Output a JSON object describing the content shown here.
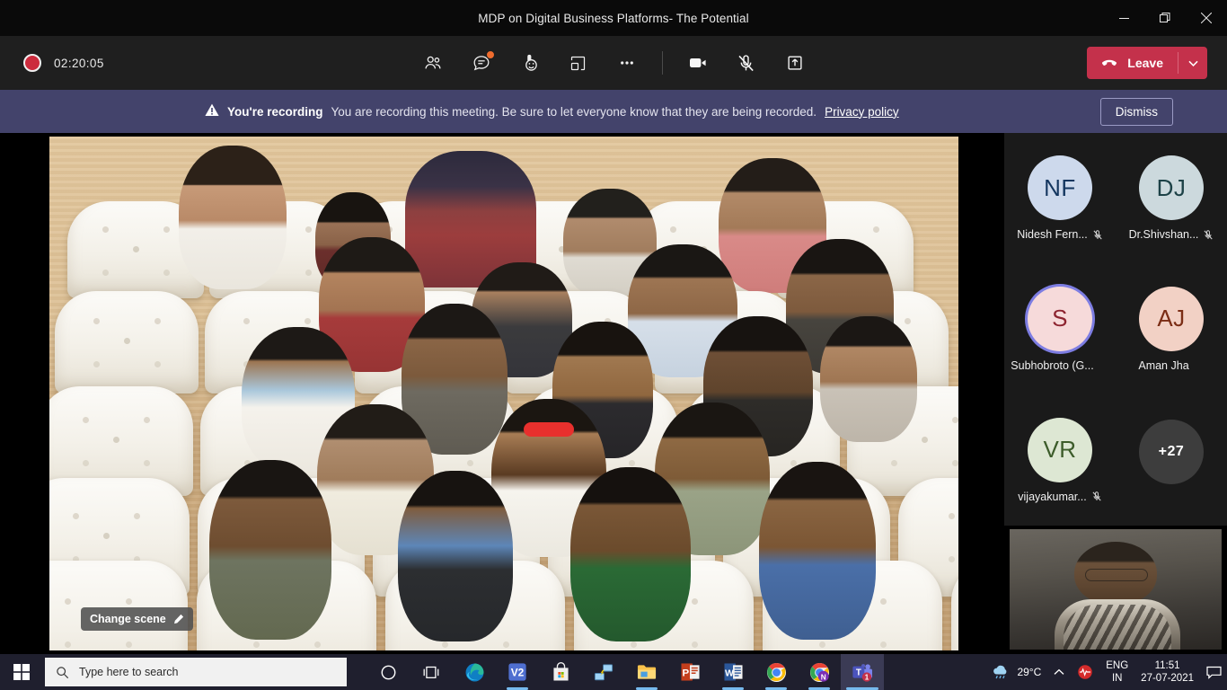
{
  "window": {
    "title": "MDP on Digital Business Platforms- The Potential",
    "controls": {
      "minimize": "minimize-button",
      "restore": "restore-button",
      "close": "close-button"
    }
  },
  "toolbar": {
    "recording_time": "02:20:05",
    "buttons": [
      {
        "name": "show-participants",
        "icon": "people-icon",
        "label": "People"
      },
      {
        "name": "show-conversation",
        "icon": "chat-icon",
        "label": "Chat",
        "badge": true
      },
      {
        "name": "show-reactions",
        "icon": "reactions-icon",
        "label": "React"
      },
      {
        "name": "breakout-rooms",
        "icon": "breakout-rooms-icon",
        "label": "Rooms"
      },
      {
        "name": "more-actions",
        "icon": "ellipsis-icon",
        "label": "More"
      }
    ],
    "camera": {
      "name": "camera-toggle",
      "icon": "camera-icon",
      "state": "on"
    },
    "mic": {
      "name": "mic-toggle",
      "icon": "mic-muted-icon",
      "state": "muted"
    },
    "share": {
      "name": "share-content",
      "icon": "share-screen-icon"
    },
    "leave_label": "Leave",
    "leave_caret": "chevron-down-icon"
  },
  "banner": {
    "warning_icon": "warning-triangle-icon",
    "strong": "You're recording",
    "text": "You are recording this meeting. Be sure to let everyone know that they are being recorded.",
    "link": "Privacy policy",
    "dismiss_label": "Dismiss",
    "background": "#43436b"
  },
  "stage": {
    "mode": "together-mode-auditorium",
    "change_scene_label": "Change scene",
    "change_scene_icon": "pencil-icon"
  },
  "rail": {
    "participants": [
      {
        "initials": "NF",
        "name": "Nidesh Fern...",
        "bg": "#cdd9ec",
        "fg": "#14365f",
        "muted": true,
        "speaking": false
      },
      {
        "initials": "DJ",
        "name": "Dr.Shivshan...",
        "bg": "#ccd9dd",
        "fg": "#1d4247",
        "muted": true,
        "speaking": false
      },
      {
        "initials": "S",
        "name": "Subhobroto (G...",
        "bg": "#f6dada",
        "fg": "#8d2430",
        "muted": false,
        "speaking": true
      },
      {
        "initials": "AJ",
        "name": "Aman Jha",
        "bg": "#f2d1c5",
        "fg": "#7b2d15",
        "muted": false,
        "speaking": false
      },
      {
        "initials": "VR",
        "name": "vijayakumar...",
        "bg": "#dde7d3",
        "fg": "#3c5c2a",
        "muted": true,
        "speaking": false
      }
    ],
    "overflow": {
      "label": "+27",
      "bg": "#3d3d3d",
      "fg": "#ffffff"
    },
    "self_view": {
      "name": "self-video-tile"
    }
  },
  "taskbar": {
    "start": "windows-start-icon",
    "search_placeholder": "Type here to search",
    "search_icon": "search-icon",
    "items": [
      {
        "name": "cortana-icon",
        "label": "Cortana"
      },
      {
        "name": "task-view-icon",
        "label": "Task View"
      },
      {
        "name": "microsoft-edge-icon",
        "label": "Microsoft Edge"
      },
      {
        "name": "vn-app-icon",
        "label": "V2"
      },
      {
        "name": "microsoft-store-icon",
        "label": "Microsoft Store"
      },
      {
        "name": "remote-connection-icon",
        "label": "Remote"
      },
      {
        "name": "file-explorer-icon",
        "label": "File Explorer"
      },
      {
        "name": "powerpoint-icon",
        "label": "PowerPoint"
      },
      {
        "name": "word-icon",
        "label": "Word"
      },
      {
        "name": "chrome-icon",
        "label": "Google Chrome"
      },
      {
        "name": "chrome-profile-icon",
        "label": "Chrome"
      },
      {
        "name": "microsoft-teams-icon",
        "label": "Microsoft Teams",
        "badge": "1"
      }
    ],
    "tray": {
      "weather_icon": "cloud-rain-icon",
      "weather": "29°C",
      "chevron": "chevron-up-icon",
      "tray_app_icon": "red-heartbeat-icon",
      "language_line1": "ENG",
      "language_line2": "IN",
      "time": "11:51",
      "date": "27-07-2021",
      "notifications_icon": "notification-center-icon"
    }
  }
}
